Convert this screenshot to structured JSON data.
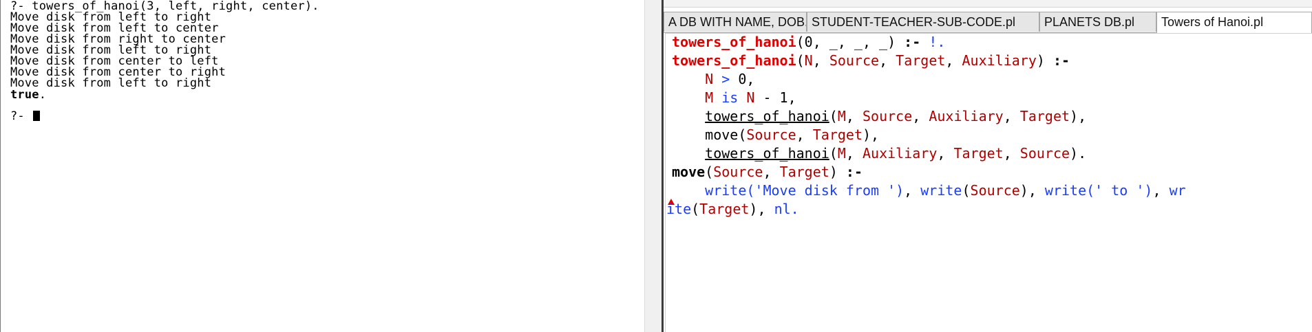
{
  "console": {
    "lines": [
      "?- towers_of_hanoi(3, left, right, center).",
      "Move disk from left to right",
      "Move disk from left to center",
      "Move disk from right to center",
      "Move disk from left to right",
      "Move disk from center to left",
      "Move disk from center to right",
      "Move disk from left to right"
    ],
    "result": "true",
    "result_punct": ".",
    "prompt": "?- "
  },
  "editor": {
    "tabs": [
      {
        "label": "A DB WITH NAME, DOB.pl",
        "active": false
      },
      {
        "label": "STUDENT-TEACHER-SUB-CODE.pl",
        "active": false
      },
      {
        "label": "PLANETS DB.pl",
        "active": false
      },
      {
        "label": "Towers of Hanoi.pl",
        "active": true
      }
    ],
    "code": {
      "l1": {
        "pred": "towers_of_hanoi",
        "a": "(0, _, _, _) ",
        "neck": ":-",
        "sp": " ",
        "cut": "!",
        "end": "."
      },
      "l2": {
        "pred": "towers_of_hanoi",
        "p1": "(",
        "v1": "N",
        "c1": ", ",
        "v2": "Source",
        "c2": ", ",
        "v3": "Target",
        "c3": ", ",
        "v4": "Auxiliary",
        "p2": ") ",
        "neck": ":-"
      },
      "l3": {
        "indent": "    ",
        "v": "N",
        "op": " > ",
        "n": "0,"
      },
      "l4": {
        "indent": "    ",
        "v": "M",
        "op": " is ",
        "v2": "N",
        "rest": " - 1,"
      },
      "l5": {
        "indent": "    ",
        "call": "towers_of_hanoi",
        "p1": "(",
        "v1": "M",
        "c1": ", ",
        "v2": "Source",
        "c2": ", ",
        "v3": "Auxiliary",
        "c3": ", ",
        "v4": "Target",
        "end": "),"
      },
      "l6": {
        "indent": "    ",
        "call": "move",
        "p1": "(",
        "v1": "Source",
        "c1": ", ",
        "v2": "Target",
        "end": "),"
      },
      "l7": {
        "indent": "    ",
        "call": "towers_of_hanoi",
        "p1": "(",
        "v1": "M",
        "c1": ", ",
        "v2": "Auxiliary",
        "c2": ", ",
        "v3": "Target",
        "c3": ", ",
        "v4": "Source",
        "end": ")."
      },
      "l8": {
        "head": "move",
        "p1": "(",
        "v1": "Source",
        "c1": ", ",
        "v2": "Target",
        "p2": ") ",
        "neck": ":-"
      },
      "l9": {
        "indent": "    ",
        "w1": "write",
        "s1": "('Move disk from ')",
        "c1": ", ",
        "w2": "write",
        "p1": "(",
        "v1": "Source",
        "p2": ")",
        "c2": ", ",
        "w3": "write",
        "s2": "(' to ')",
        "c3": ", ",
        "w4": "wr"
      },
      "l10": {
        "w": "ite",
        "p1": "(",
        "v": "Target",
        "p2": ")",
        "c": ", ",
        "nl": "nl",
        "end": "."
      }
    }
  },
  "colors": {
    "predicate": "#e00000",
    "variable": "#b00000",
    "builtin": "#1a3cff",
    "splitter": "#3c3c3c"
  }
}
